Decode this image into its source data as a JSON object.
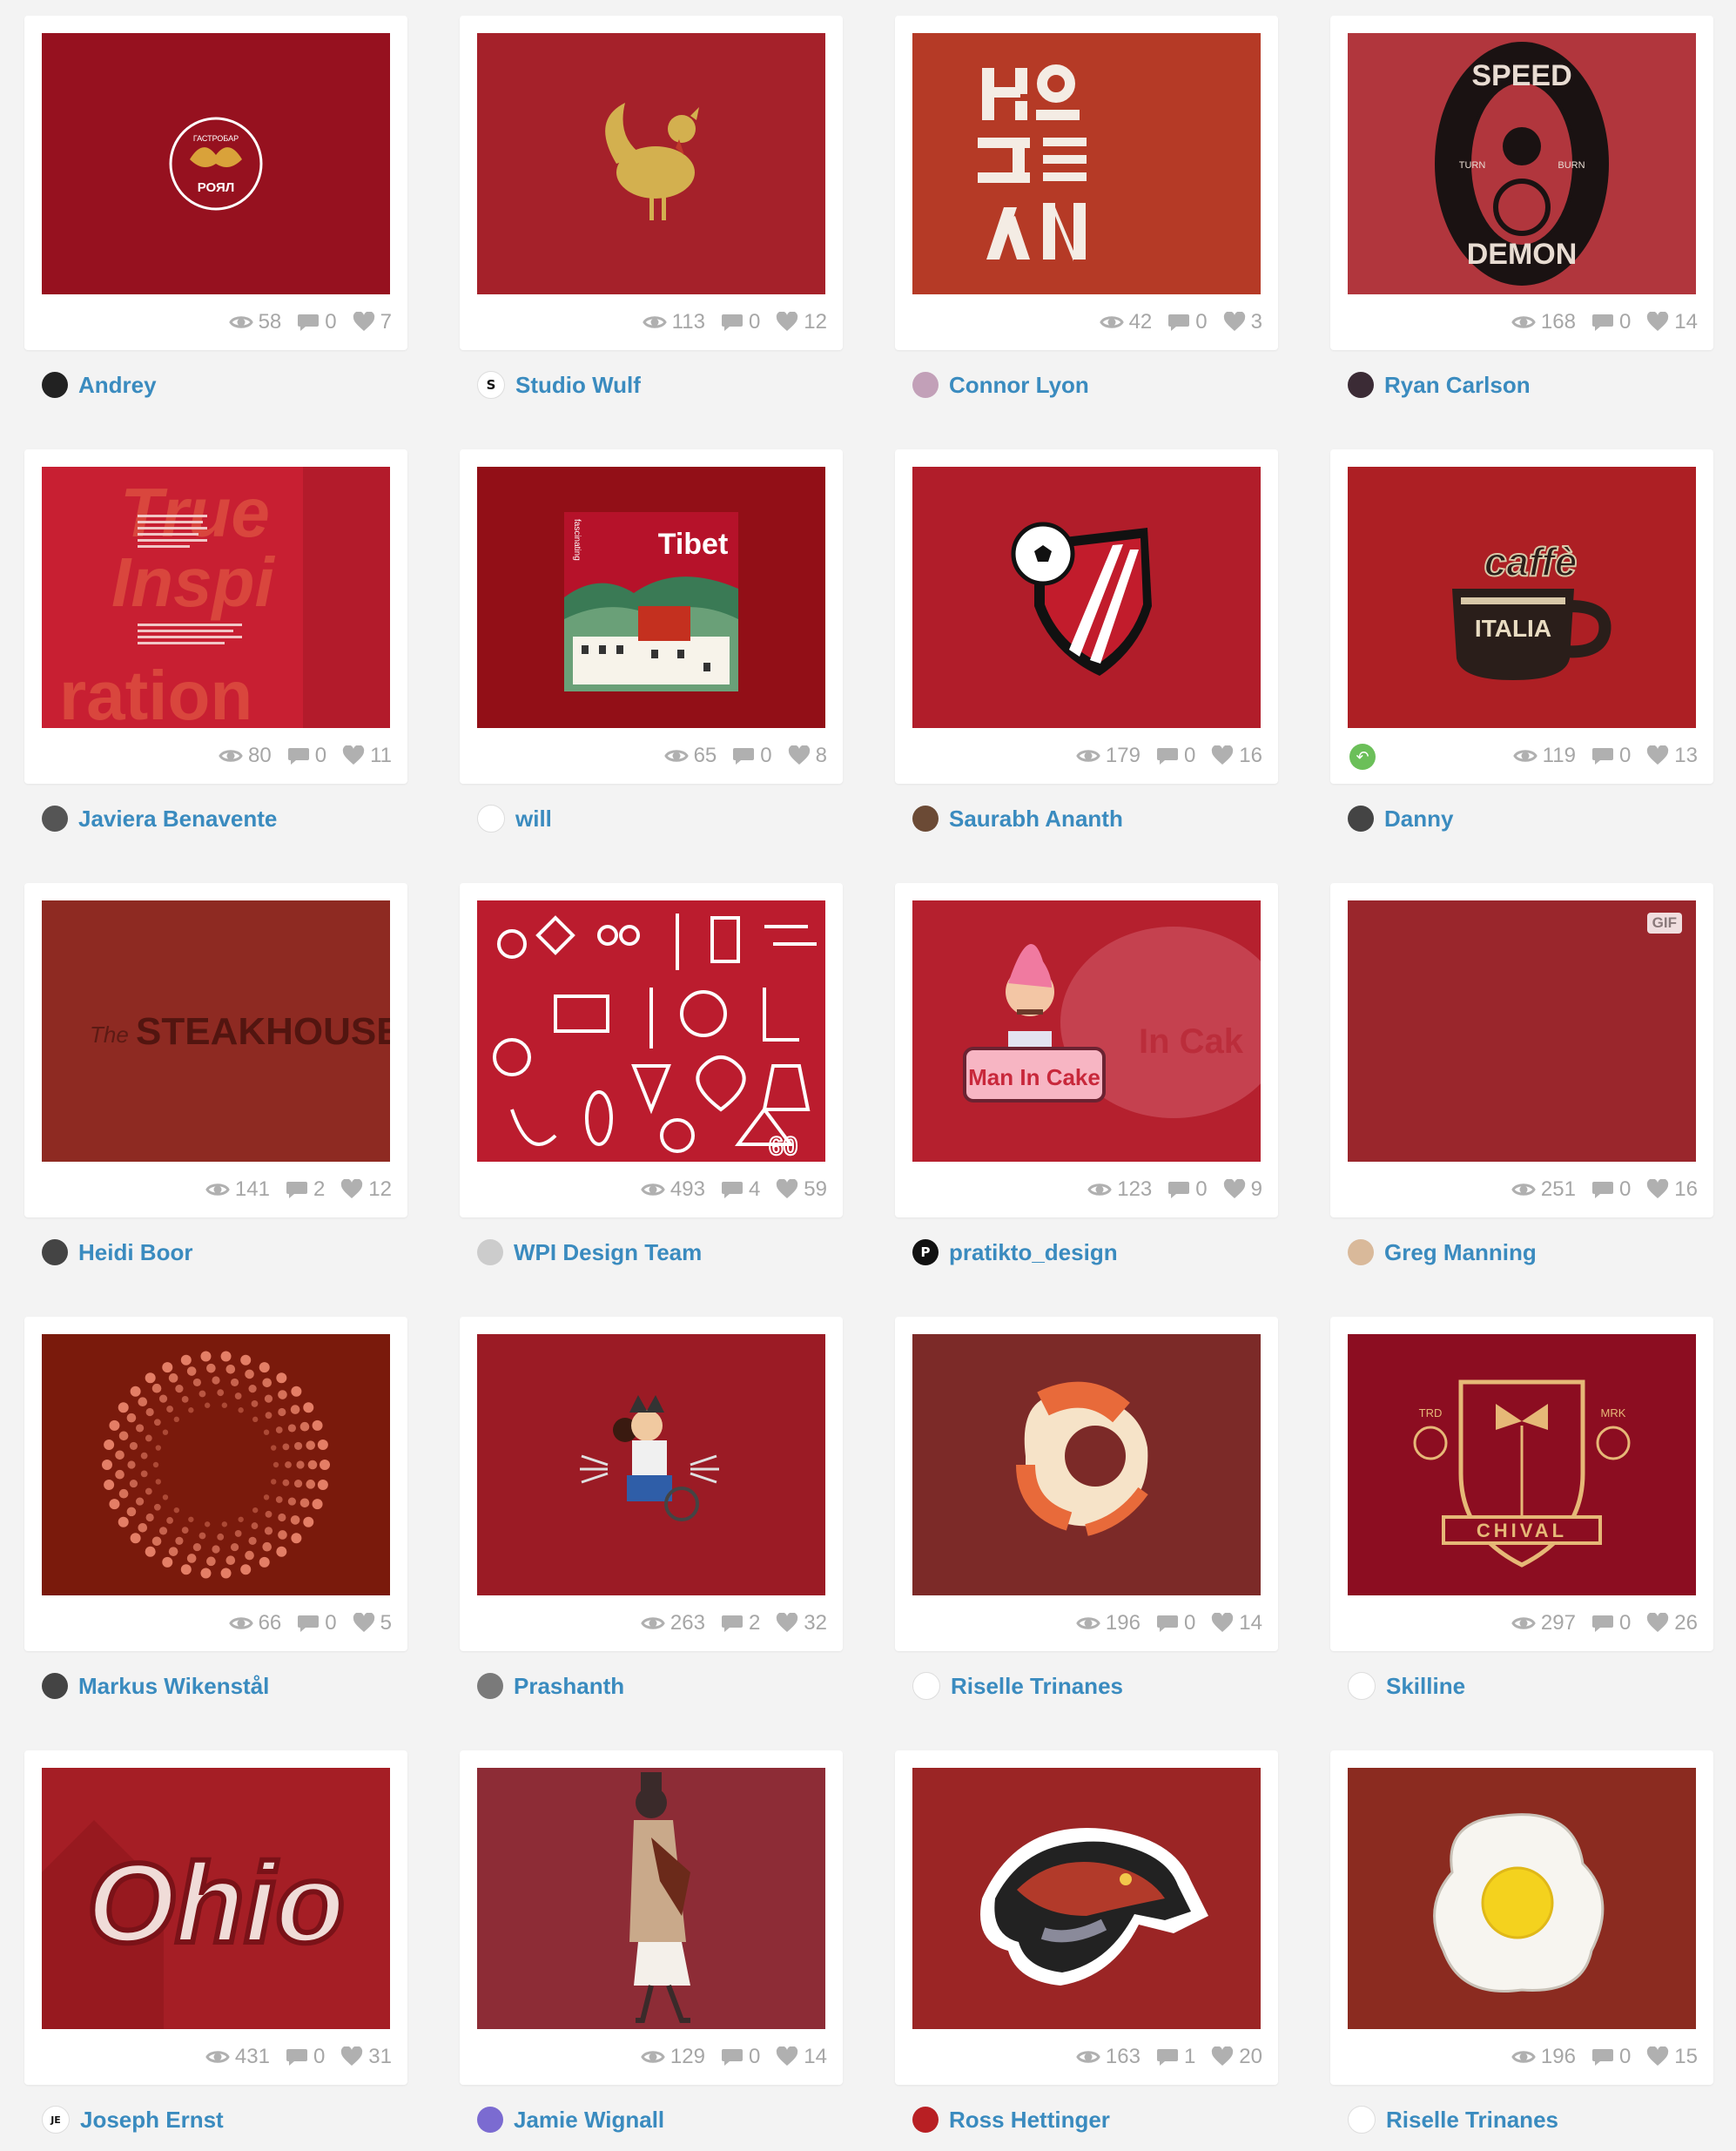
{
  "shots": [
    {
      "author": "Andrey",
      "views": "58",
      "comments": "0",
      "likes": "7",
      "bg": "#96111f",
      "art": "royal-logo",
      "art_text": [
        "ГАСТРОБАР",
        "РОЯЛ"
      ],
      "avatar_color": "#222222",
      "avatar_glyph": "",
      "rebound": false,
      "gif": false
    },
    {
      "author": "Studio Wulf",
      "views": "113",
      "comments": "0",
      "likes": "12",
      "bg": "#a5212a",
      "art": "golden-rooster",
      "art_text": [],
      "avatar_color": "#ffffff",
      "avatar_glyph": "S",
      "rebound": false,
      "gif": false
    },
    {
      "author": "Connor Lyon",
      "views": "42",
      "comments": "0",
      "likes": "3",
      "bg": "#b53a26",
      "art": "korean-type",
      "art_text": [],
      "avatar_color": "#c2a0b8",
      "avatar_glyph": "",
      "rebound": false,
      "gif": false
    },
    {
      "author": "Ryan Carlson",
      "views": "168",
      "comments": "0",
      "likes": "14",
      "bg": "#b1363d",
      "art": "speed-demon-badge",
      "art_text": [
        "SPEED",
        "DEMON",
        "TURN",
        "BURN"
      ],
      "avatar_color": "#3b2b35",
      "avatar_glyph": "",
      "rebound": false,
      "gif": false
    },
    {
      "author": "Javiera Benavente",
      "views": "80",
      "comments": "0",
      "likes": "11",
      "bg": "#b31b2b",
      "art": "true-inspiration-poster",
      "art_text": [
        "True",
        "Inspi",
        "ration"
      ],
      "avatar_color": "#555555",
      "avatar_glyph": "",
      "rebound": false,
      "gif": false
    },
    {
      "author": "will",
      "views": "65",
      "comments": "0",
      "likes": "8",
      "bg": "#920f17",
      "art": "tibet-book",
      "art_text": [
        "Tibet",
        "fascinating"
      ],
      "avatar_color": "#ffffff",
      "avatar_glyph": "",
      "rebound": false,
      "gif": false
    },
    {
      "author": "Saurabh Ananth",
      "views": "179",
      "comments": "0",
      "likes": "16",
      "bg": "#b11d2a",
      "art": "football-shield",
      "art_text": [],
      "avatar_color": "#6b4a35",
      "avatar_glyph": "",
      "rebound": false,
      "gif": false
    },
    {
      "author": "Danny",
      "views": "119",
      "comments": "0",
      "likes": "13",
      "bg": "#ad1f24",
      "art": "caffe-italia-cup",
      "art_text": [
        "caffè",
        "ITALIA"
      ],
      "avatar_color": "#444444",
      "avatar_glyph": "",
      "rebound": true,
      "gif": false
    },
    {
      "author": "Heidi Boor",
      "views": "141",
      "comments": "2",
      "likes": "12",
      "bg": "#8e2a22",
      "art": "steakhouse-wordmark",
      "art_text": [
        "The",
        "STEAKHOUSE"
      ],
      "avatar_color": "#444444",
      "avatar_glyph": "",
      "rebound": false,
      "gif": false
    },
    {
      "author": "WPI Design Team",
      "views": "493",
      "comments": "4",
      "likes": "59",
      "bg": "#bb1c2e",
      "art": "science-icons-pattern",
      "art_text": [
        "60"
      ],
      "avatar_color": "#cccccc",
      "avatar_glyph": "",
      "rebound": false,
      "gif": false
    },
    {
      "author": "pratikto_design",
      "views": "123",
      "comments": "0",
      "likes": "9",
      "bg": "#b5202e",
      "art": "man-in-cake",
      "art_text": [
        "Man In Cake",
        "In Cak"
      ],
      "avatar_color": "#111111",
      "avatar_glyph": "P",
      "rebound": false,
      "gif": false
    },
    {
      "author": "Greg Manning",
      "views": "251",
      "comments": "0",
      "likes": "16",
      "bg": "#9a262c",
      "art": "blank-gif",
      "art_text": [],
      "gif_label": "GIF",
      "avatar_color": "#d9b99a",
      "avatar_glyph": "",
      "rebound": false,
      "gif": true
    },
    {
      "author": "Markus Wikenstål",
      "views": "66",
      "comments": "0",
      "likes": "5",
      "bg": "#7a1a0c",
      "art": "dotted-sphere",
      "art_text": [],
      "avatar_color": "#444444",
      "avatar_glyph": "",
      "rebound": false,
      "gif": false
    },
    {
      "author": "Prashanth",
      "views": "263",
      "comments": "2",
      "likes": "32",
      "bg": "#9b1b25",
      "art": "wolverine-character",
      "art_text": [],
      "avatar_color": "#7a7a7a",
      "avatar_glyph": "",
      "rebound": false,
      "gif": false
    },
    {
      "author": "Riselle Trinanes",
      "views": "196",
      "comments": "0",
      "likes": "14",
      "bg": "#7c2a28",
      "art": "shrimp",
      "art_text": [],
      "avatar_color": "#ffffff",
      "avatar_glyph": "",
      "rebound": false,
      "gif": false
    },
    {
      "author": "Skilline",
      "views": "297",
      "comments": "0",
      "likes": "26",
      "bg": "#8c0d21",
      "art": "chival-crest",
      "art_text": [
        "TRD",
        "MRK",
        "CHIVAL"
      ],
      "avatar_color": "#ffffff",
      "avatar_glyph": "",
      "rebound": false,
      "gif": false
    },
    {
      "author": "Joseph Ernst",
      "views": "431",
      "comments": "0",
      "likes": "31",
      "bg": "#a51e25",
      "art": "ohio-script",
      "art_text": [
        "Ohio"
      ],
      "avatar_color": "#ffffff",
      "avatar_glyph": "JE",
      "rebound": false,
      "gif": false
    },
    {
      "author": "Jamie Wignall",
      "views": "129",
      "comments": "0",
      "likes": "14",
      "bg": "#8d2c36",
      "art": "walking-woman",
      "art_text": [],
      "avatar_color": "#7b6bd1",
      "avatar_glyph": "",
      "rebound": false,
      "gif": false
    },
    {
      "author": "Ross Hettinger",
      "views": "163",
      "comments": "1",
      "likes": "20",
      "bg": "#9b2525",
      "art": "raptor-mascot",
      "art_text": [],
      "avatar_color": "#b81f23",
      "avatar_glyph": "",
      "rebound": false,
      "gif": false
    },
    {
      "author": "Riselle Trinanes",
      "views": "196",
      "comments": "0",
      "likes": "15",
      "bg": "#8b2b20",
      "art": "fried-egg",
      "art_text": [],
      "avatar_color": "#ffffff",
      "avatar_glyph": "",
      "rebound": false,
      "gif": false
    }
  ],
  "icons": {
    "views": "eye-icon",
    "comments": "comment-icon",
    "likes": "heart-icon",
    "rebound": "rebound-icon"
  }
}
